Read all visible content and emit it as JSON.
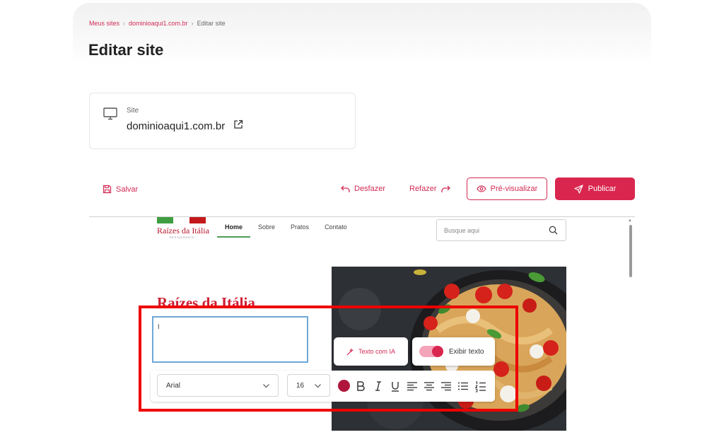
{
  "breadcrumb": [
    "Meus sites",
    "dominioaqui1.com.br",
    "Editar site"
  ],
  "page_title": "Editar site",
  "site_card": {
    "label": "Site",
    "domain": "dominioaqui1.com.br",
    "icon": "monitor-icon",
    "link_icon": "external-link-icon"
  },
  "toolbar": {
    "save_label": "Salvar",
    "undo_label": "Desfazer",
    "redo_label": "Refazer",
    "preview_label": "Pré-visualizar",
    "publish_label": "Publicar"
  },
  "site_preview": {
    "logo": {
      "name": "Raízes da Itália",
      "tagline": "RESTAURANTE"
    },
    "nav": [
      "Home",
      "Sobre",
      "Pratos",
      "Contato"
    ],
    "nav_active": "Home",
    "search_placeholder": "Busque aqui",
    "hero_title": "Raízes da Itália"
  },
  "editor": {
    "text_value": "I",
    "ai_button_label": "Texto com IA",
    "show_text_label": "Exibir texto",
    "show_text_on": true,
    "font_family": "Arial",
    "font_size": "16",
    "text_color": "#b0163c"
  },
  "colors": {
    "accent": "#d9264f",
    "highlight": "#ee0000"
  }
}
